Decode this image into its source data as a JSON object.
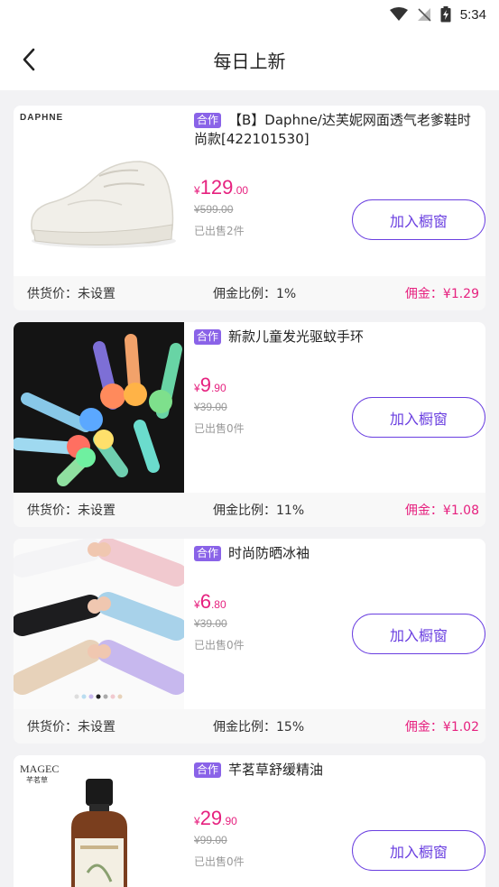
{
  "status": {
    "time": "5:34"
  },
  "nav": {
    "title": "每日上新"
  },
  "colors": {
    "accent": "#6a3fe0",
    "price": "#e6217f",
    "tag": "#8a63e8"
  },
  "icons": {
    "back": "chevron-left-icon",
    "wifi": "wifi-icon",
    "signal": "no-signal-icon",
    "battery": "battery-charging-icon"
  },
  "products": [
    {
      "tag": "合作",
      "name": "【B】Daphne/达芙妮网面透气老爹鞋时尚款[422101530]",
      "brand": "DAPHNE",
      "price_cur": "¥",
      "price_int": "129",
      "price_dec": ".00",
      "orig": "¥599.00",
      "sold": "已出售2件",
      "button": "加入橱窗",
      "supply": "供货价：未设置",
      "rate": "佣金比例：1%",
      "commission": "佣金：¥1.29"
    },
    {
      "tag": "合作",
      "name": "新款儿童发光驱蚊手环",
      "brand": "",
      "price_cur": "¥",
      "price_int": "9",
      "price_dec": ".90",
      "orig": "¥39.00",
      "sold": "已出售0件",
      "button": "加入橱窗",
      "supply": "供货价：未设置",
      "rate": "佣金比例：11%",
      "commission": "佣金：¥1.08"
    },
    {
      "tag": "合作",
      "name": "时尚防晒冰袖",
      "brand": "",
      "price_cur": "¥",
      "price_int": "6",
      "price_dec": ".80",
      "orig": "¥39.00",
      "sold": "已出售0件",
      "button": "加入橱窗",
      "supply": "供货价：未设置",
      "rate": "佣金比例：15%",
      "commission": "佣金：¥1.02"
    },
    {
      "tag": "合作",
      "name": "芊茗草舒缓精油",
      "brand": "MAGEC",
      "brand_sub": "芊茗草",
      "price_cur": "¥",
      "price_int": "29",
      "price_dec": ".90",
      "orig": "¥99.00",
      "sold": "已出售0件",
      "button": "加入橱窗"
    }
  ]
}
